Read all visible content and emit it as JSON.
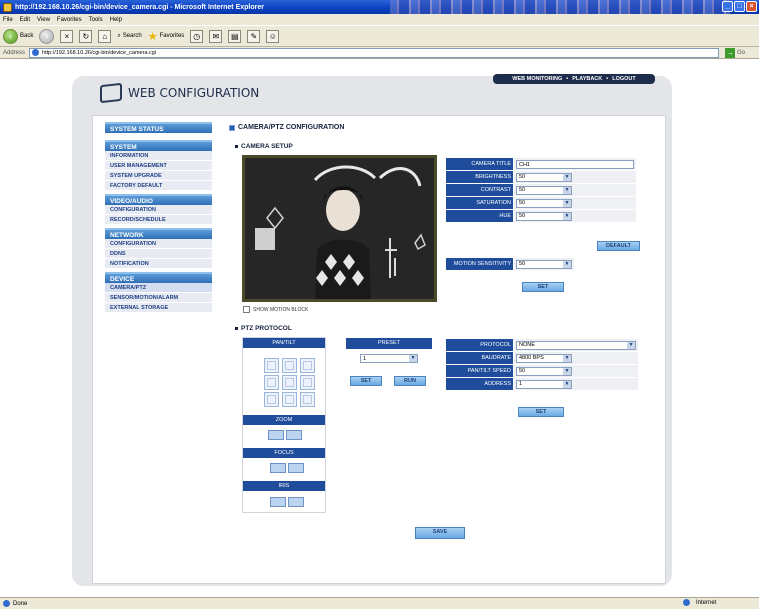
{
  "browser": {
    "title": "http://192.168.10.26/cgi-bin/device_camera.cgi - Microsoft Internet Explorer",
    "menu": [
      "File",
      "Edit",
      "View",
      "Favorites",
      "Tools",
      "Help"
    ],
    "back_label": "Back",
    "search_label": "Search",
    "favorites_label": "Favorites",
    "address_label": "Address",
    "address_value": "http://192.168.10.26/cgi-bin/device_camera.cgi",
    "go_label": "Go",
    "status_text": "Done",
    "zone_text": "Internet"
  },
  "page": {
    "header_title": "WEB CONFIGURATION",
    "topnav": [
      "WEB MONITORING",
      "PLAYBACK",
      "LOGOUT"
    ],
    "topnav_sep": "•"
  },
  "sidebar": {
    "system_status": "SYSTEM STATUS",
    "system": {
      "title": "SYSTEM",
      "items": [
        "INFORMATION",
        "USER MANAGEMENT",
        "SYSTEM UPGRADE",
        "FACTORY DEFAULT"
      ]
    },
    "video_audio": {
      "title": "VIDEO/AUDIO",
      "items": [
        "CONFIGURATION",
        "RECORD/SCHEDULE"
      ]
    },
    "network": {
      "title": "NETWORK",
      "items": [
        "CONFIGURATION",
        "DDNS",
        "NOTIFICATION"
      ]
    },
    "device": {
      "title": "DEVICE",
      "items": [
        "CAMERA/PTZ",
        "SENSOR/MOTION/ALARM",
        "EXTERNAL STORAGE"
      ]
    }
  },
  "main": {
    "title": "CAMERA/PTZ CONFIGURATION",
    "camera_setup": {
      "title": "CAMERA SETUP",
      "camera_title_label": "CAMERA TITLE",
      "camera_title_value": "CH1",
      "brightness_label": "BRIGHTNESS",
      "brightness_value": "50",
      "contrast_label": "CONTRAST",
      "contrast_value": "50",
      "saturation_label": "SATURATION",
      "saturation_value": "50",
      "hue_label": "HUE",
      "hue_value": "50",
      "default_button": "DEFAULT",
      "motion_sensitivity_label": "MOTION SENSITIVITY",
      "motion_sensitivity_value": "50",
      "set_button": "SET",
      "show_motion_block": "SHOW MOTION BLOCK"
    },
    "ptz": {
      "title": "PTZ PROTOCOL",
      "pan_tilt_label": "PAN/TILT",
      "zoom_label": "ZOOM",
      "focus_label": "FOCUS",
      "iris_label": "IRIS",
      "preset_label": "PRESET",
      "preset_value": "1",
      "set_button": "SET",
      "run_button": "RUN",
      "protocol_label": "PROTOCOL",
      "protocol_value": "NONE",
      "baudrate_label": "BAUDRATE",
      "baudrate_value": "4800 BPS",
      "pan_tilt_speed_label": "PAN/TILT SPEED",
      "pan_tilt_speed_value": "50",
      "address_label": "ADDRESS",
      "address_value": "1",
      "set_button2": "SET"
    },
    "save_button": "SAVE",
    "arrow_down": "▼"
  }
}
